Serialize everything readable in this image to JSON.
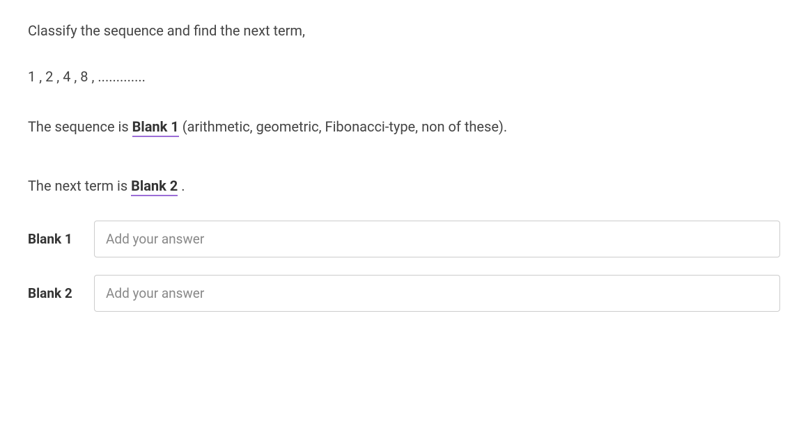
{
  "question": {
    "prompt": "Classify the sequence and find the next term,",
    "sequence": "1 , 2 , 4 , 8 , .............",
    "statement1_prefix": "The sequence is ",
    "statement1_blank": "Blank 1",
    "statement1_suffix": " (arithmetic, geometric, Fibonacci-type, non of these).",
    "statement2_prefix": "The next term is ",
    "statement2_blank": "Blank 2",
    "statement2_suffix": " ."
  },
  "answers": {
    "blank1": {
      "label": "Blank 1",
      "placeholder": "Add your answer",
      "value": ""
    },
    "blank2": {
      "label": "Blank 2",
      "placeholder": "Add your answer",
      "value": ""
    }
  }
}
